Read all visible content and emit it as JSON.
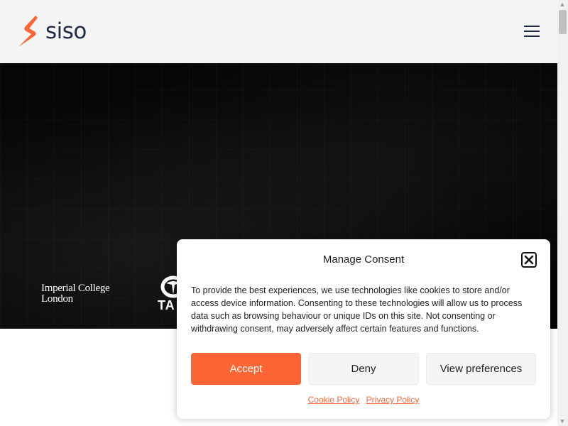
{
  "header": {
    "brand": "siso",
    "logo_icon": "siso-bolt-logo-icon",
    "menu_icon": "hamburger-menu-icon"
  },
  "hero": {
    "client_logos": [
      {
        "name": "imperial",
        "line1": "Imperial College",
        "line2": "London"
      },
      {
        "name": "tata",
        "text": "TA"
      }
    ]
  },
  "consent": {
    "title": "Manage Consent",
    "close_icon": "close-icon",
    "body": "To provide the best experiences, we use technologies like cookies to store and/or access device information. Consenting to these technologies will allow us to process data such as browsing behaviour or unique IDs on this site. Not consenting or withdrawing consent, may adversely affect certain features and functions.",
    "accept_label": "Accept",
    "deny_label": "Deny",
    "preferences_label": "View preferences",
    "cookie_policy_label": "Cookie Policy",
    "privacy_policy_label": "Privacy Policy"
  },
  "colors": {
    "accent": "#fe6534",
    "brand_dark": "#1f2a44",
    "hero_bg": "#060606",
    "header_bg": "#f5f5f5"
  }
}
